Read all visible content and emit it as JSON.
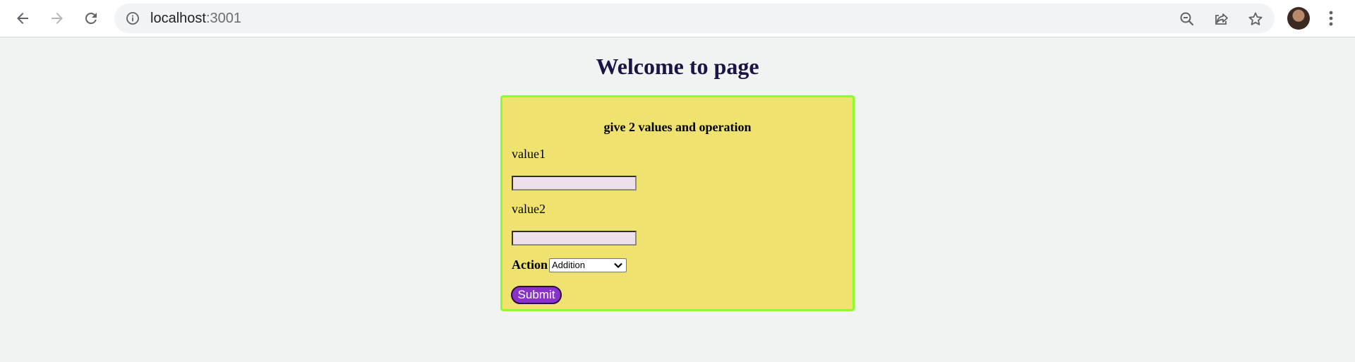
{
  "browser": {
    "url_host": "localhost",
    "url_port": ":3001",
    "icons": [
      "back-arrow-icon",
      "forward-arrow-icon",
      "reload-icon",
      "info-icon",
      "zoom-out-icon",
      "share-icon",
      "star-icon",
      "avatar",
      "kebab-menu-icon"
    ]
  },
  "page": {
    "title": "Welcome to page"
  },
  "form": {
    "heading": "give 2 values and operation",
    "value1_label": "value1",
    "value1_value": "",
    "value2_label": "value2",
    "value2_value": "",
    "action_label": "Action",
    "action_selected": "Addition",
    "submit_label": "Submit"
  },
  "colors": {
    "page_bg": "#f0f3f2",
    "title": "#1c1445",
    "card_bg": "#efe26f",
    "card_border": "#8dfd2b",
    "input_bg": "#ede0ea",
    "submit_bg": "#8a31c9"
  }
}
